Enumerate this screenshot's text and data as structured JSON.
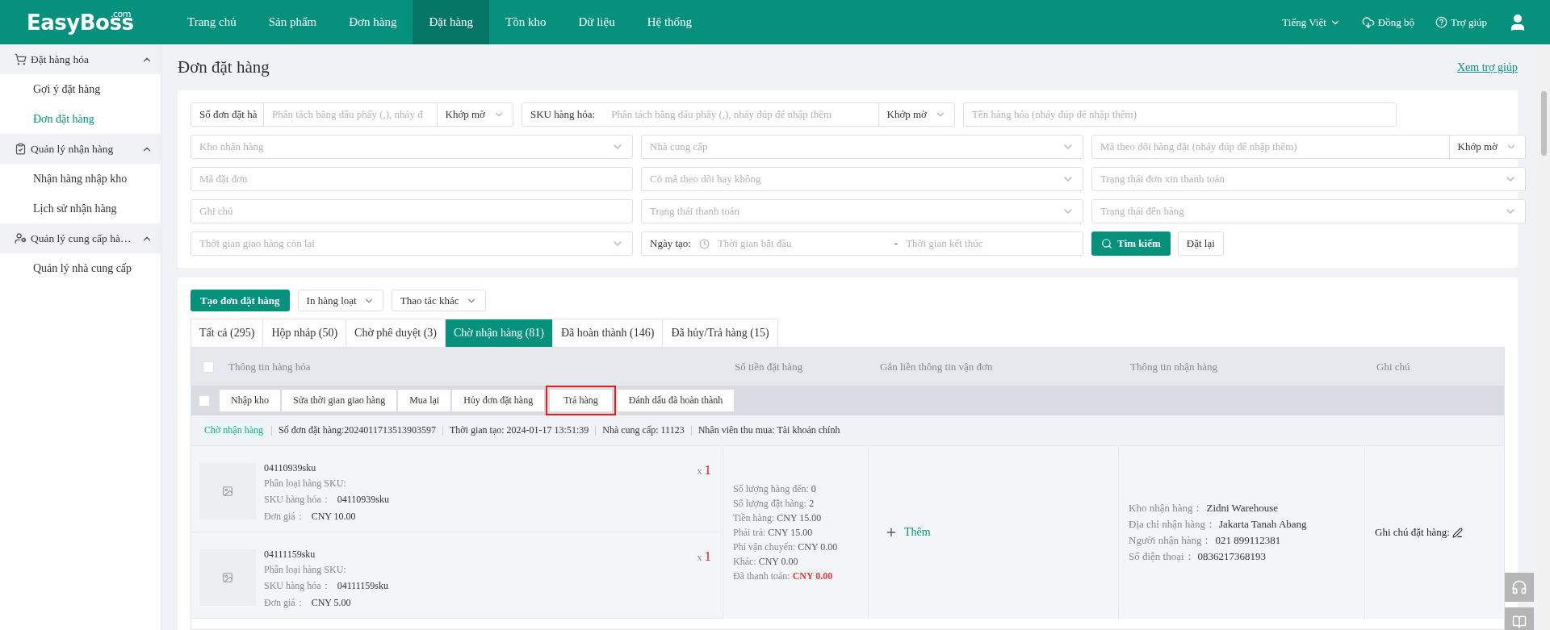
{
  "header": {
    "logo": "EasyBoss",
    "logo_suffix": ".com",
    "menu": [
      {
        "label": "Trang chủ",
        "selected": false
      },
      {
        "label": "Sản phẩm",
        "selected": false
      },
      {
        "label": "Đơn hàng",
        "selected": false
      },
      {
        "label": "Đặt hàng",
        "selected": true
      },
      {
        "label": "Tồn kho",
        "selected": false
      },
      {
        "label": "Dữ liệu",
        "selected": false
      },
      {
        "label": "Hệ thống",
        "selected": false
      }
    ],
    "language": "Tiếng Việt",
    "sync": "Đồng bộ",
    "help": "Trợ giúp"
  },
  "sidebar": [
    {
      "label": "Đặt hàng hóa",
      "kind": "cart",
      "expanded": true,
      "children": [
        {
          "label": "Gợi ý đặt hàng",
          "selected": false
        },
        {
          "label": "Đơn đặt hàng",
          "selected": true
        }
      ]
    },
    {
      "label": "Quản lý nhận hàng",
      "kind": "clipboard",
      "expanded": true,
      "children": [
        {
          "label": "Nhận hàng nhập kho",
          "selected": false
        },
        {
          "label": "Lịch sử nhận hàng",
          "selected": false
        }
      ]
    },
    {
      "label": "Quản lý cung cấp hà…",
      "kind": "person",
      "expanded": true,
      "children": [
        {
          "label": "Quản lý nhà cung cấp",
          "selected": false
        }
      ]
    }
  ],
  "page": {
    "title": "Đơn đặt hàng",
    "help_link": "Xem trợ giúp"
  },
  "filters": {
    "first_row": [
      {
        "kind": "boxed",
        "label": "Số đơn đặt hà",
        "placeholder": "Phân tách bằng dấu phẩy (,), nháy đ",
        "match": "Khớp mờ"
      },
      {
        "kind": "inline",
        "label": "SKU hàng hóa:",
        "placeholder": "Phân tách bằng dấu phẩy (,), nháy đúp để nhập thêm",
        "match": "Khớp mờ"
      },
      {
        "kind": "input",
        "placeholder": "Tên hàng hóa (nháy đúp để nhập thêm)"
      }
    ],
    "grid": [
      {
        "kind": "select",
        "placeholder": "Kho nhận hàng"
      },
      {
        "kind": "select",
        "placeholder": "Nhà cung cấp"
      },
      {
        "kind": "match",
        "placeholder": "Mã theo dõi hàng đặt (nháy đúp để nhập thêm)",
        "match": "Khớp mờ"
      },
      {
        "kind": "input",
        "placeholder": "Mã đặt đơn"
      },
      {
        "kind": "select",
        "placeholder": "Có mã theo dõi hay không"
      },
      {
        "kind": "select",
        "placeholder": "Trạng thái đơn xin thanh toán"
      },
      {
        "kind": "input",
        "placeholder": "Ghi chú"
      },
      {
        "kind": "select",
        "placeholder": "Trạng thái thanh toán"
      },
      {
        "kind": "select",
        "placeholder": "Trạng thái đến hàng"
      },
      {
        "kind": "select",
        "placeholder": "Thời gian giao hàng còn lại"
      },
      {
        "kind": "daterange",
        "label": "Ngày tạo:",
        "placeholder": "Thời gian bắt đầu",
        "separator": "-",
        "placeholder_end": "Thời gian kết thúc"
      },
      {
        "kind": "buttons",
        "search": "Tìm kiếm",
        "reset": "Đặt lại"
      }
    ]
  },
  "toolbar": {
    "create": "Tạo đơn đặt hàng",
    "print": "In hàng loạt",
    "more": "Thao tác khác"
  },
  "tabs": [
    {
      "label": "Tất cả (295)",
      "selected": false
    },
    {
      "label": "Hộp nháp (50)",
      "selected": false
    },
    {
      "label": "Chờ phê duyệt (3)",
      "selected": false
    },
    {
      "label": "Chờ nhận hàng (81)",
      "selected": true
    },
    {
      "label": "Đã hoàn thành (146)",
      "selected": false
    },
    {
      "label": "Đã hủy/Trả hàng (15)",
      "selected": false
    }
  ],
  "table": {
    "header_checkbox": {
      "checked": false
    },
    "bulk_checkbox": {
      "checked": false
    },
    "columns": [
      "Thông tin hàng hóa",
      "Số tiền đặt hàng",
      "Gắn liền thông tin vận đơn",
      "Thông tin nhận hàng",
      "Ghi chú"
    ],
    "bulk_actions": [
      {
        "label": "Nhập kho",
        "highlighted": false
      },
      {
        "label": "Sửa thời gian giao hàng",
        "highlighted": false
      },
      {
        "label": "Mua lại",
        "highlighted": false
      },
      {
        "label": "Hủy đơn đặt hàng",
        "highlighted": false
      },
      {
        "label": "Trả hàng",
        "highlighted": true
      },
      {
        "label": "Đánh dấu đã hoàn thành",
        "highlighted": false
      }
    ],
    "order": {
      "status": "Chờ nhận hàng",
      "info": [
        "Số đơn đặt hàng:2024011713513903597",
        "Thời gian tạo: 2024-01-17 13:51:39",
        "Nhà cung cấp: 11123",
        "Nhân viên thu mua: Tài khoản chính"
      ],
      "items": [
        {
          "name": "04110939sku",
          "variant_label": "Phân loại hàng SKU:",
          "sku_label": "SKU hàng hóa：",
          "sku": "04110939sku",
          "price_label": "Đơn giá：",
          "price": "CNY 10.00",
          "qty_prefix": "x",
          "qty": "1"
        },
        {
          "name": "04111159sku",
          "variant_label": "Phân loại hàng SKU:",
          "sku_label": "SKU hàng hóa：",
          "sku": "04111159sku",
          "price_label": "Đơn giá：",
          "price": "CNY 5.00",
          "qty_prefix": "x",
          "qty": "1"
        }
      ],
      "amounts": [
        {
          "label": "Số lượng hàng đến:",
          "value": "0",
          "emphasis": false
        },
        {
          "label": "Số lượng đặt hàng:",
          "value": "2",
          "emphasis": false
        },
        {
          "label": "Tiền hàng:",
          "value": "CNY 15.00",
          "emphasis": false
        },
        {
          "label": "Phải trả:",
          "value": "CNY 15.00",
          "emphasis": false
        },
        {
          "label": "Phí vận chuyển:",
          "value": "CNY 0.00",
          "emphasis": false
        },
        {
          "label": "Khác:",
          "value": "CNY 0.00",
          "emphasis": false
        },
        {
          "label": "Đã thanh toán:",
          "value": "CNY 0.00",
          "emphasis": true
        }
      ],
      "add_logistics": "Thêm",
      "receiving": [
        {
          "label": "Kho nhận hàng：",
          "value": "Zidni Warehouse"
        },
        {
          "label": "Địa chỉ nhận hàng：",
          "value": "Jakarta Tanah Abang"
        },
        {
          "label": "Người nhận hàng：",
          "value": "021 899112381"
        },
        {
          "label": "Số điện thoại：",
          "value": "0836217368193"
        }
      ],
      "note_label": "Ghi chú đặt hàng:"
    }
  }
}
